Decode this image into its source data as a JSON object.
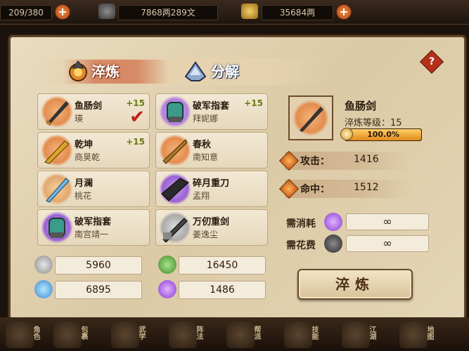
{
  "topbar": {
    "stamina": "209/380",
    "silver": "7868两289文",
    "gold": "35684两"
  },
  "tabs": [
    {
      "label": "淬炼",
      "active": true
    },
    {
      "label": "分解",
      "active": false
    }
  ],
  "help_label": "?",
  "equipment": [
    {
      "name": "鱼肠剑",
      "owner": "瑛",
      "level": "+15",
      "selected": true,
      "icon": "sword-icon"
    },
    {
      "name": "破军指套",
      "owner": "拜妮娜",
      "level": "+15",
      "selected": false,
      "icon": "gauntlet-icon"
    },
    {
      "name": "乾坤",
      "owner": "商昊乾",
      "level": "+15",
      "selected": false,
      "icon": "blade-icon"
    },
    {
      "name": "春秋",
      "owner": "南知意",
      "level": "",
      "selected": false,
      "icon": "saber-icon"
    },
    {
      "name": "月澜",
      "owner": "桃花",
      "level": "",
      "selected": false,
      "icon": "sword-icon"
    },
    {
      "name": "碎月重刀",
      "owner": "孟翔",
      "level": "",
      "selected": false,
      "icon": "greatblade-icon"
    },
    {
      "name": "破军指套",
      "owner": "南宫靖一",
      "level": "",
      "selected": false,
      "icon": "gauntlet-icon"
    },
    {
      "name": "万仞重剑",
      "owner": "姜逸尘",
      "level": "",
      "selected": false,
      "icon": "greatsword-icon"
    }
  ],
  "materials": [
    {
      "value": "5960",
      "icon": "silver-ore-icon",
      "color": "#b9b9b9"
    },
    {
      "value": "16450",
      "icon": "jade-ore-icon",
      "color": "#5fa84a"
    },
    {
      "value": "6895",
      "icon": "blue-crystal-icon",
      "color": "#4aa6e0"
    },
    {
      "value": "1486",
      "icon": "purple-crystal-icon",
      "color": "#a55ad6"
    }
  ],
  "detail": {
    "name": "鱼肠剑",
    "refine_level_label": "淬炼等级：15",
    "progress_label": "100.0%",
    "progress": 1.0,
    "attack_label": "攻击：",
    "attack_value": "1416",
    "hit_label": "命中：",
    "hit_value": "1512",
    "cost_label": "需消耗",
    "cost_value": "∞",
    "fee_label": "需花费",
    "fee_value": "∞",
    "refine_button": "淬炼"
  },
  "nav": [
    {
      "label": "角色"
    },
    {
      "label": "包裹"
    },
    {
      "label": "武学"
    },
    {
      "label": "阵法"
    },
    {
      "label": "帮派"
    },
    {
      "label": "技能"
    },
    {
      "label": "江湖"
    },
    {
      "label": "地图"
    }
  ],
  "colors": {
    "accent": "#c84f26",
    "panel": "#e4d5b6",
    "border": "#5e4328"
  }
}
